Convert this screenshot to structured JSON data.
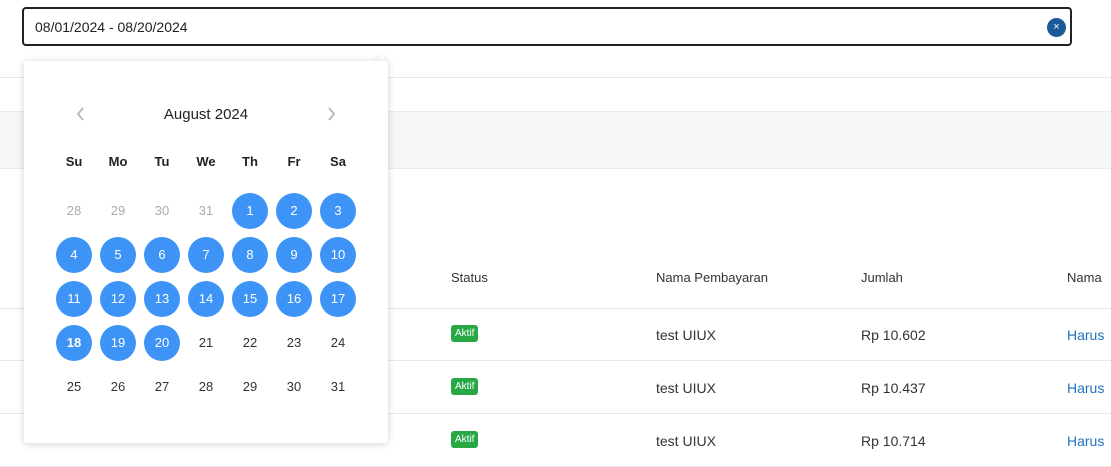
{
  "date_range": {
    "value": "08/01/2024 - 08/20/2024",
    "clear_icon": "×"
  },
  "calendar": {
    "month_label": "August 2024",
    "weekdays": [
      "Su",
      "Mo",
      "Tu",
      "We",
      "Th",
      "Fr",
      "Sa"
    ],
    "weeks": [
      [
        "28",
        "29",
        "30",
        "31",
        "1",
        "2",
        "3"
      ],
      [
        "4",
        "5",
        "6",
        "7",
        "8",
        "9",
        "10"
      ],
      [
        "11",
        "12",
        "13",
        "14",
        "15",
        "16",
        "17"
      ],
      [
        "18",
        "19",
        "20",
        "21",
        "22",
        "23",
        "24"
      ],
      [
        "25",
        "26",
        "27",
        "28",
        "29",
        "30",
        "31"
      ]
    ],
    "range_start_day": 1,
    "range_end_day": 20,
    "emphasized_day": 18,
    "selected_color": "#3d94f6"
  },
  "table": {
    "headers": {
      "status": "Status",
      "payment_name": "Nama Pembayaran",
      "amount": "Jumlah",
      "name": "Nama"
    },
    "rows": [
      {
        "status": "Aktif",
        "payment_name": "test UIUX",
        "amount": "Rp 10.602",
        "name": "Harus"
      },
      {
        "status": "Aktif",
        "payment_name": "test UIUX",
        "amount": "Rp 10.437",
        "name": "Harus"
      },
      {
        "status": "Aktif",
        "payment_name": "test UIUX",
        "amount": "Rp 10.714",
        "name": "Harus"
      }
    ]
  },
  "colors": {
    "status_active": "#28a745",
    "link": "#1e73be",
    "clear_button": "#1a5a96"
  }
}
